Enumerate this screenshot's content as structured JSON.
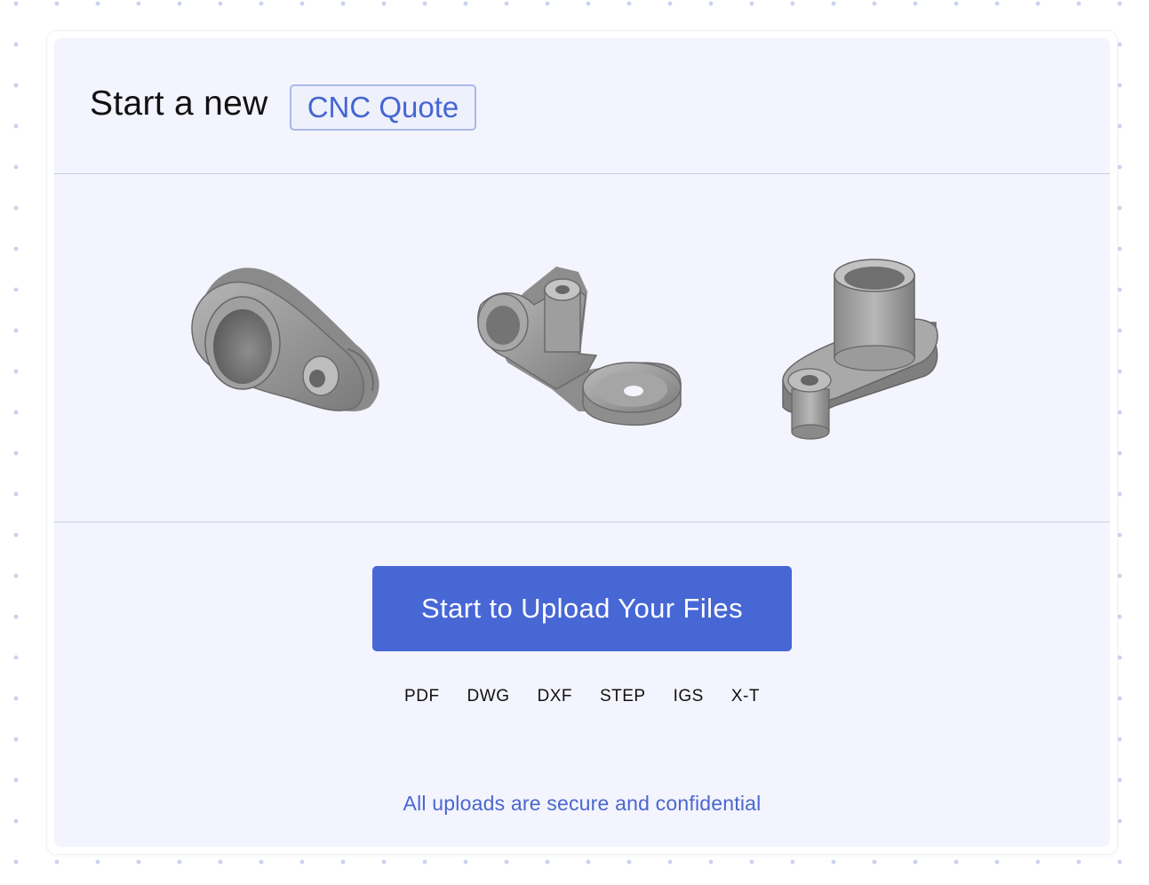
{
  "header": {
    "title_prefix": "Start a new",
    "badge_label": "CNC Quote"
  },
  "gallery": {
    "items": [
      {
        "icon": "cnc-part-cam-lever-icon"
      },
      {
        "icon": "cnc-part-bracket-arm-icon"
      },
      {
        "icon": "cnc-part-flanged-bushing-icon"
      }
    ]
  },
  "upload": {
    "button_label": "Start to Upload Your Files",
    "formats": [
      "PDF",
      "DWG",
      "DXF",
      "STEP",
      "IGS",
      "X-T"
    ],
    "security_note": "All uploads are secure and confidential"
  },
  "colors": {
    "accent": "#4767d5",
    "card_background": "#f3f4fd",
    "badge_border": "#a8b9e9",
    "divider": "#c3d0e6"
  }
}
